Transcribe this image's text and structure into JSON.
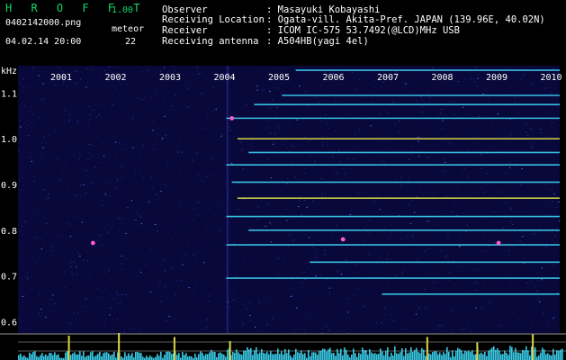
{
  "header": {
    "app_title": "H R O F F T",
    "version": "1.00",
    "filename": "0402142000.png",
    "meteor_label": "meteor",
    "datetime": "04.02.14 20:00",
    "meteor_count": "22",
    "observer_label": "Observer",
    "observer_value": ": Masayuki Kobayashi",
    "location_label": "Receiving Location",
    "location_value": ": Ogata-vill. Akita-Pref. JAPAN (139.96E, 40.02N)",
    "receiver_label": "Receiver",
    "receiver_value": ": ICOM IC-575 53.7492(@LCD)MHz USB",
    "antenna_label": "Receiving antenna",
    "antenna_value": ": A504HB(yagi 4el)"
  },
  "axis": {
    "unit": "kHz",
    "freq_ticks": [
      "1.1",
      "1.0",
      "0.9",
      "0.8",
      "0.7",
      "0.6"
    ],
    "freq_values": [
      1.1,
      1.0,
      0.9,
      0.8,
      0.7,
      0.6
    ],
    "years": [
      "2001",
      "2002",
      "2003",
      "2004",
      "2005",
      "2006",
      "2007",
      "2008",
      "2009",
      "2010"
    ]
  },
  "colors": {
    "background": "#000000",
    "spectrogram_bg": "#08083a",
    "title_green": "#12d86a",
    "signal_cyan": "#3ee0ff",
    "signal_yellow": "#e8e84a",
    "meteor_pink": "#ff5ad0",
    "divider": "#9a9a9a",
    "grid_yellow": "#d8d84a"
  },
  "spectrogram": {
    "freq_min": 0.575,
    "freq_max": 1.16,
    "carriers": [
      {
        "freq": 1.15,
        "from": 2005.25,
        "to": 2010.0,
        "color": "#3ee0ff"
      },
      {
        "freq": 1.095,
        "from": 2005.0,
        "to": 2010.0,
        "color": "#3ee0ff"
      },
      {
        "freq": 1.075,
        "from": 2004.5,
        "to": 2010.0,
        "color": "#3ee0ff"
      },
      {
        "freq": 1.045,
        "from": 2004.0,
        "to": 2010.0,
        "color": "#3ee0ff"
      },
      {
        "freq": 1.0,
        "from": 2004.2,
        "to": 2010.0,
        "color": "#e8e84a"
      },
      {
        "freq": 0.97,
        "from": 2004.4,
        "to": 2010.0,
        "color": "#3ee0ff"
      },
      {
        "freq": 0.943,
        "from": 2004.0,
        "to": 2010.0,
        "color": "#3ee0ff"
      },
      {
        "freq": 0.905,
        "from": 2004.1,
        "to": 2010.0,
        "color": "#3ee0ff"
      },
      {
        "freq": 0.87,
        "from": 2004.2,
        "to": 2010.0,
        "color": "#e8e84a"
      },
      {
        "freq": 0.83,
        "from": 2004.0,
        "to": 2010.0,
        "color": "#3ee0ff"
      },
      {
        "freq": 0.8,
        "from": 2004.4,
        "to": 2010.0,
        "color": "#3ee0ff"
      },
      {
        "freq": 0.768,
        "from": 2004.0,
        "to": 2010.0,
        "color": "#3ee0ff"
      },
      {
        "freq": 0.73,
        "from": 2005.5,
        "to": 2010.0,
        "color": "#3ee0ff"
      },
      {
        "freq": 0.695,
        "from": 2004.0,
        "to": 2010.0,
        "color": "#3ee0ff"
      },
      {
        "freq": 0.66,
        "from": 2006.8,
        "to": 2010.0,
        "color": "#3ee0ff"
      }
    ],
    "meteors": [
      {
        "year": 2001.6,
        "freq": 0.772
      },
      {
        "year": 2004.1,
        "freq": 1.045
      },
      {
        "year": 2006.1,
        "freq": 0.78
      },
      {
        "year": 2008.9,
        "freq": 0.772
      }
    ]
  },
  "count_bars": {
    "tall": [
      {
        "year": 2001.15,
        "level": 0.9
      },
      {
        "year": 2002.05,
        "level": 1.0
      },
      {
        "year": 2003.05,
        "level": 0.85
      },
      {
        "year": 2004.05,
        "level": 0.7
      },
      {
        "year": 2007.6,
        "level": 0.85
      },
      {
        "year": 2008.5,
        "level": 0.65
      },
      {
        "year": 2009.5,
        "level": 0.95
      }
    ]
  }
}
